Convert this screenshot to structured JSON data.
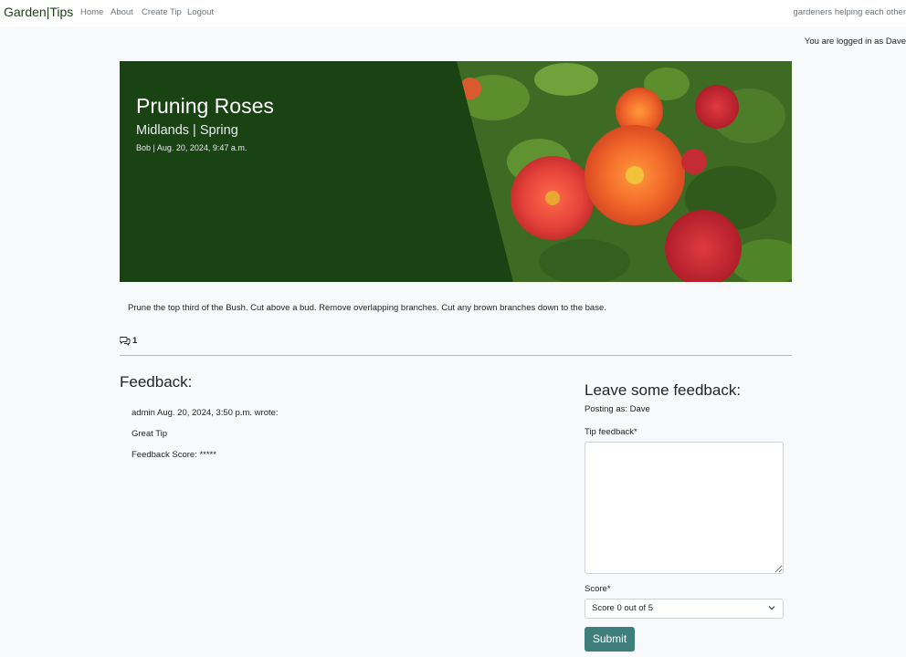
{
  "navbar": {
    "brand": "Garden|Tips",
    "links": [
      "Home",
      "About",
      "Create Tip",
      "Logout"
    ],
    "tagline": "gardeners helping each other"
  },
  "login_message": "You are logged in as Dave",
  "hero": {
    "title": "Pruning Roses",
    "subtitle": "Midlands | Spring",
    "meta": "Bob | Aug. 20, 2024, 9:47 a.m."
  },
  "content": "Prune the top third of the Bush. Cut above a bud. Remove overlapping branches. Cut any brown branches down to the base.",
  "comment_count": "1",
  "feedback": {
    "heading": "Feedback:",
    "items": [
      {
        "header": "admin Aug. 20, 2024, 3:50 p.m. wrote:",
        "body": "Great Tip",
        "score": "Feedback Score: *****"
      }
    ]
  },
  "form": {
    "heading": "Leave some feedback:",
    "posting_as": "Posting as: Dave",
    "feedback_label": "Tip feedback*",
    "feedback_value": "",
    "score_label": "Score*",
    "score_selected": "Score 0 out of 5",
    "submit_label": "Submit"
  },
  "colors": {
    "hero_bg": "#1a4314",
    "submit_bg": "#3f7f7b"
  }
}
